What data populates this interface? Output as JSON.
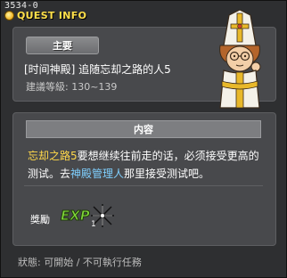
{
  "window": {
    "quest_id": "3534-0",
    "title": "QUEST INFO"
  },
  "header": {
    "tag": "主要",
    "quest_name": "[时间神殿] 追随忘却之路的人5",
    "recommended_level": "建議等級: 130~139"
  },
  "content": {
    "section_title": "内容",
    "description": {
      "part1_highlight": "忘却之路5",
      "part2": "要想继续往前走的话，必须接受更高的测试。去",
      "part3_highlight": "神殿管理人",
      "part4": "那里接受测试吧。"
    },
    "reward": {
      "label": "獎勵",
      "exp_text": "EXP",
      "item_quantity": "1"
    }
  },
  "status": {
    "text": "狀態:  可開始  / 不可執行任務"
  },
  "colors": {
    "title": "#ffe04a",
    "highlight_yellow": "#ffd84a",
    "highlight_blue": "#7fd0ff",
    "panel": "#48494c",
    "background": "#2e2f31"
  },
  "icons": [
    "lightbulb-icon",
    "npc-portrait",
    "exp-icon",
    "star-item-icon"
  ]
}
